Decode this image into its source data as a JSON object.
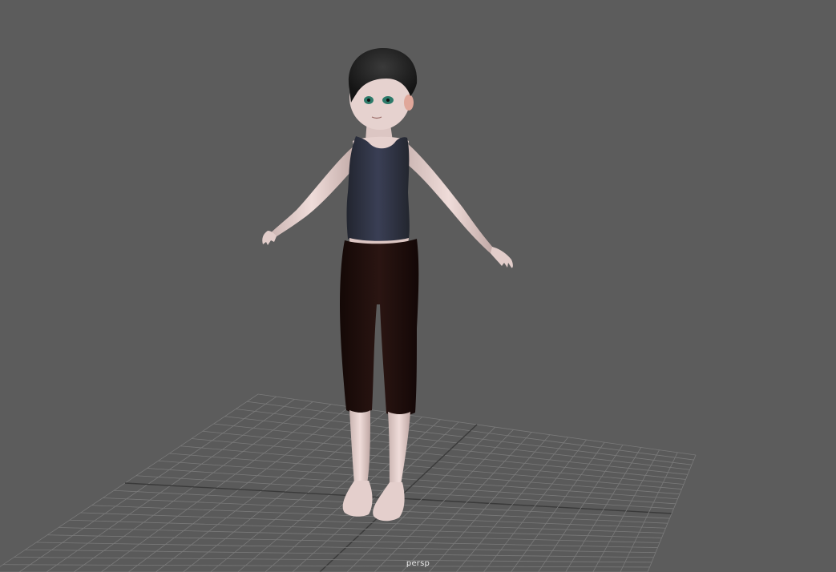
{
  "viewport": {
    "camera_name": "persp",
    "background_color": "#5c5c5c",
    "grid_color": "#7a7a7a",
    "grid_axis_color": "#3a3a3a"
  },
  "character": {
    "skin_color": "#e8d3d0",
    "hair_color": "#1e1e1e",
    "top_color": "#2c3040",
    "pants_color": "#1e0f0d",
    "eye_color": "#2d7a6a"
  }
}
